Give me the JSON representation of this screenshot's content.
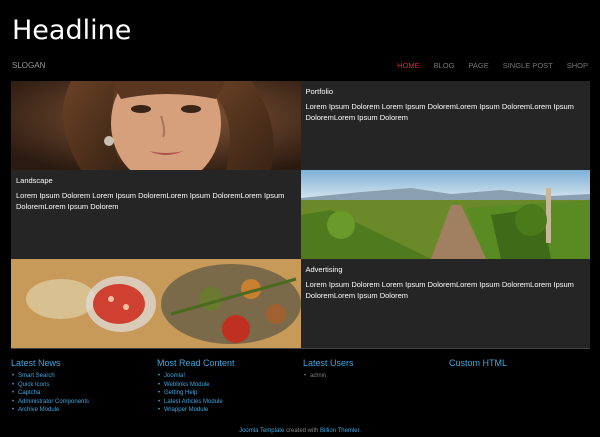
{
  "header": {
    "headline": "Headline",
    "slogan": "SLOGAN",
    "nav": [
      {
        "label": "HOME",
        "active": true
      },
      {
        "label": "BLOG",
        "active": false
      },
      {
        "label": "PAGE",
        "active": false
      },
      {
        "label": "SINGLE POST",
        "active": false
      },
      {
        "label": "SHOP",
        "active": false
      }
    ]
  },
  "grid": {
    "portfolio": {
      "title": "Portfolio",
      "text": "Lorem Ipsum Dolorem Lorem Ipsum DoloremLorem Ipsum DoloremLorem Ipsum DoloremLorem Ipsum Dolorem"
    },
    "landscape": {
      "title": "Landscape",
      "text": "Lorem Ipsum Dolorem Lorem Ipsum DoloremLorem Ipsum DoloremLorem Ipsum DoloremLorem Ipsum Dolorem"
    },
    "advertising": {
      "title": "Advertising",
      "text": "Lorem Ipsum Dolorem Lorem Ipsum DoloremLorem Ipsum DoloremLorem Ipsum DoloremLorem Ipsum Dolorem"
    }
  },
  "footer": {
    "latest_news": {
      "title": "Latest News",
      "items": [
        "Smart Search",
        "Quick Icons",
        "Captcha",
        "Administrator Components",
        "Archive Module"
      ]
    },
    "most_read": {
      "title": "Most Read Content",
      "items": [
        "Joomla!",
        "Weblinks Module",
        "Getting Help",
        "Latest Articles Module",
        "Wrapper Module"
      ]
    },
    "latest_users": {
      "title": "Latest Users",
      "items": [
        "admin"
      ]
    },
    "custom_html": {
      "title": "Custom HTML"
    }
  },
  "credits": {
    "link1": "Joomla Template",
    "middle": " created with ",
    "link2": "Billion Themler",
    "end": "."
  },
  "colors": {
    "accent": "#3fa7e0",
    "nav_active": "#e02020",
    "panel": "#252525",
    "background": "#000000"
  }
}
